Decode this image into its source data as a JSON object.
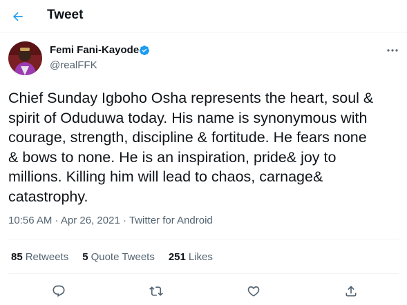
{
  "header": {
    "title": "Tweet",
    "back_icon": "arrow-left-icon"
  },
  "author": {
    "name": "Femi Fani-Kayode",
    "handle": "@realFFK",
    "verified_icon": "verified-badge-icon"
  },
  "tweet": {
    "text": "Chief Sunday Igboho Osha represents the heart, soul &\nspirit of Oduduwa today. His name is synonymous with\ncourage, strength, discipline & fortitude. He fears none\n& bows to none. He is an inspiration, pride& joy to\nmillions. Killing him will lead to chaos, carnage&\ncatastrophy.",
    "time": "10:56 AM",
    "separator1": " · ",
    "date": "Apr 26, 2021",
    "separator2": " · ",
    "source": "Twitter for Android"
  },
  "stats": {
    "retweets_count": "85",
    "retweets_label": "Retweets",
    "quotes_count": "5",
    "quotes_label": "Quote Tweets",
    "likes_count": "251",
    "likes_label": "Likes"
  },
  "colors": {
    "accent": "#1d9bf0",
    "text_primary": "#0f1419",
    "text_secondary": "#536471",
    "divider": "#eff3f4"
  }
}
